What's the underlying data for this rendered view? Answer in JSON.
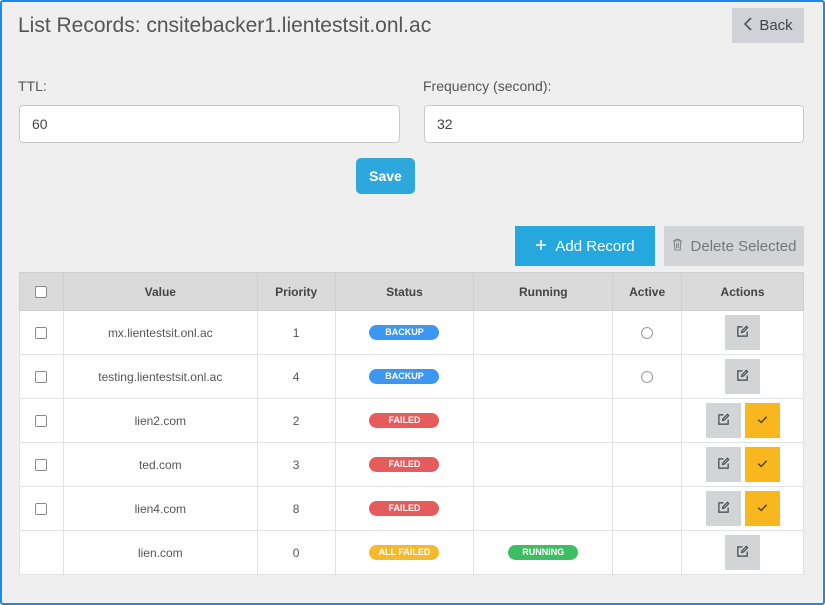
{
  "header": {
    "title": "List Records: cnsitebacker1.lientestsit.onl.ac",
    "back_label": "Back"
  },
  "form": {
    "ttl_label": "TTL:",
    "ttl_value": "60",
    "frequency_label": "Frequency (second):",
    "frequency_value": "32",
    "save_label": "Save"
  },
  "toolbar": {
    "add_label": "Add Record",
    "delete_label": "Delete Selected"
  },
  "table": {
    "columns": [
      "Value",
      "Priority",
      "Status",
      "Running",
      "Active",
      "Actions"
    ],
    "rows": [
      {
        "value": "mx.lientestsit.onl.ac",
        "priority": "1",
        "status": "BACKUP",
        "running": "",
        "active": "radio",
        "checkbox": true,
        "actions": [
          "edit"
        ]
      },
      {
        "value": "testing.lientestsit.onl.ac",
        "priority": "4",
        "status": "BACKUP",
        "running": "",
        "active": "radio",
        "checkbox": true,
        "actions": [
          "edit"
        ]
      },
      {
        "value": "lien2.com",
        "priority": "2",
        "status": "FAILED",
        "running": "",
        "active": "",
        "checkbox": true,
        "actions": [
          "edit",
          "activate"
        ]
      },
      {
        "value": "ted.com",
        "priority": "3",
        "status": "FAILED",
        "running": "",
        "active": "",
        "checkbox": true,
        "actions": [
          "edit",
          "activate"
        ]
      },
      {
        "value": "lien4.com",
        "priority": "8",
        "status": "FAILED",
        "running": "",
        "active": "",
        "checkbox": true,
        "actions": [
          "edit",
          "activate"
        ]
      },
      {
        "value": "lien.com",
        "priority": "0",
        "status": "ALL FAILED",
        "running": "RUNNING",
        "active": "",
        "checkbox": false,
        "actions": [
          "edit"
        ]
      }
    ]
  },
  "icons": {
    "back": "chevron-left-icon",
    "add": "plus-icon",
    "delete": "trash-icon",
    "edit": "edit-icon",
    "activate": "check-icon"
  },
  "colors": {
    "frame_border": "#1e88e5",
    "primary": "#26a7dd",
    "backup": "#3b97f2",
    "failed": "#e65c5c",
    "all_failed": "#f6b92e",
    "running": "#3dbe62",
    "activate_button": "#f8b61f"
  }
}
